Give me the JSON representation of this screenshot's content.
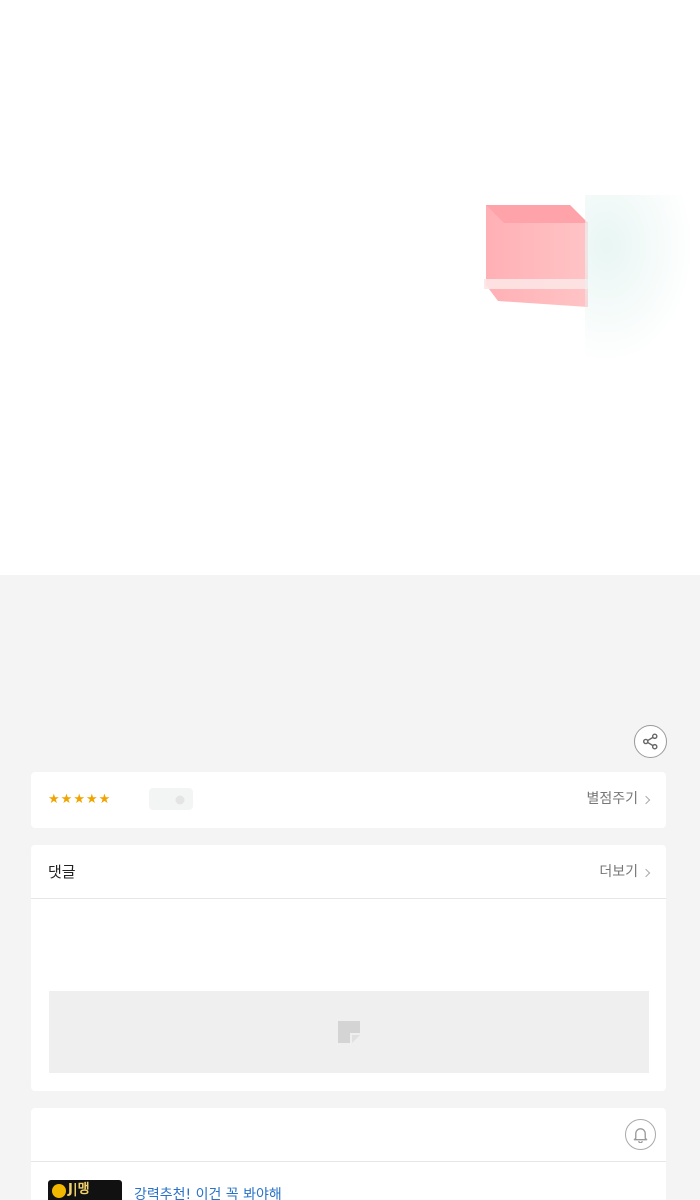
{
  "rating": {
    "stars": [
      "★",
      "★",
      "★",
      "★",
      "★"
    ],
    "rate_link": "별점주기"
  },
  "comments": {
    "title": "댓글",
    "more_link": "더보기"
  },
  "recommend": {
    "thumb_tag": "J|맹",
    "item_title": "강력추천! 이건 꼭 봐야해"
  },
  "colors": {
    "star": "#f0a400",
    "link_blue": "#2a72c8",
    "page_bg": "#f4f4f4"
  }
}
